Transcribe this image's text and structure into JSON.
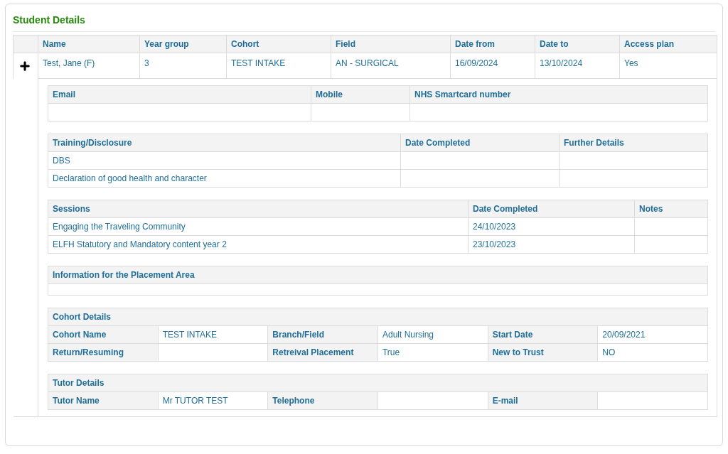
{
  "title": "Student Details",
  "students": {
    "columns": [
      "Name",
      "Year group",
      "Cohort",
      "Field",
      "Date from",
      "Date to",
      "Access plan"
    ],
    "rows": [
      {
        "expanded": true,
        "cells": [
          "Test, Jane (F)",
          "3",
          "TEST INTAKE",
          "AN - SURGICAL",
          "16/09/2024",
          "13/10/2024",
          "Yes"
        ]
      }
    ]
  },
  "contact": {
    "columns": [
      "Email",
      "Mobile",
      "NHS Smartcard number"
    ],
    "rows": [
      [
        null,
        null,
        null
      ]
    ]
  },
  "training": {
    "columns": [
      "Training/Disclosure",
      "Date Completed",
      "Further Details"
    ],
    "rows": [
      [
        "DBS",
        null,
        null
      ],
      [
        "Declaration of good health and character",
        null,
        null
      ]
    ]
  },
  "sessions": {
    "columns": [
      "Sessions",
      "Date Completed",
      "Notes"
    ],
    "rows": [
      [
        "Engaging the Traveling Community",
        "24/10/2023",
        null
      ],
      [
        "ELFH Statutory and Mandatory content year 2",
        "23/10/2023",
        null
      ]
    ]
  },
  "placement_info": {
    "title": "Information for the Placement Area"
  },
  "cohort_details": {
    "title": "Cohort Details",
    "rows": [
      [
        {
          "label": "Cohort Name",
          "value": "TEST INTAKE"
        },
        {
          "label": "Branch/Field",
          "value": "Adult Nursing"
        },
        {
          "label": "Start Date",
          "value": "20/09/2021"
        }
      ],
      [
        {
          "label": "Return/Resuming"
        },
        {
          "label": "Retreival Placement",
          "value": "True"
        },
        {
          "label": "New to Trust",
          "value": "NO"
        }
      ]
    ]
  },
  "tutor_details": {
    "title": "Tutor Details",
    "rows": [
      [
        {
          "label": "Tutor Name",
          "value": "Mr TUTOR TEST"
        },
        {
          "label": "Telephone"
        },
        {
          "label": "E-mail"
        }
      ]
    ]
  }
}
